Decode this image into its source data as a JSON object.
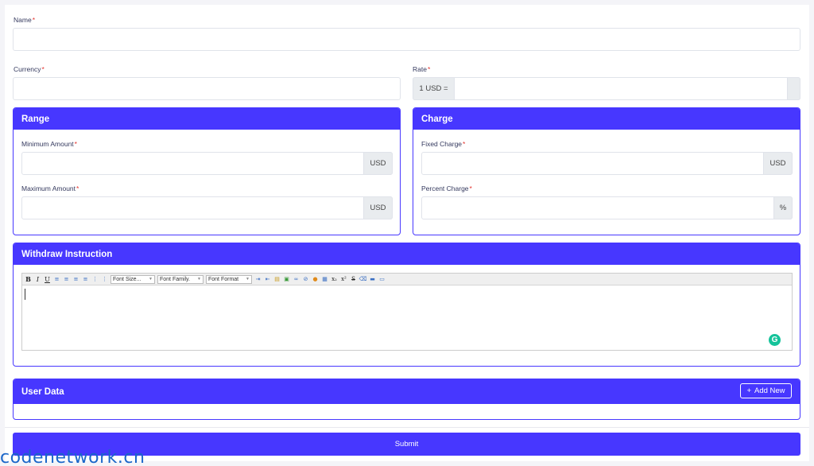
{
  "form": {
    "name_label": "Name",
    "required_mark": "*",
    "currency_label": "Currency",
    "rate_label": "Rate",
    "rate_prefix": "1 USD =",
    "submit_label": "Submit"
  },
  "range": {
    "title": "Range",
    "min_label": "Minimum Amount",
    "max_label": "Maximum Amount",
    "currency_suffix": "USD"
  },
  "charge": {
    "title": "Charge",
    "fixed_label": "Fixed Charge",
    "percent_label": "Percent Charge",
    "fixed_suffix": "USD",
    "percent_suffix": "%"
  },
  "instruction": {
    "title": "Withdraw Instruction",
    "toolbar": {
      "bold": "B",
      "italic": "I",
      "underline": "U",
      "font_size": "Font Size...",
      "font_family": "Font Family.",
      "font_format": "Font Format"
    }
  },
  "user_data": {
    "title": "User Data",
    "add_label": "Add New",
    "add_icon": "+"
  },
  "watermark": "codenetwork.cn"
}
